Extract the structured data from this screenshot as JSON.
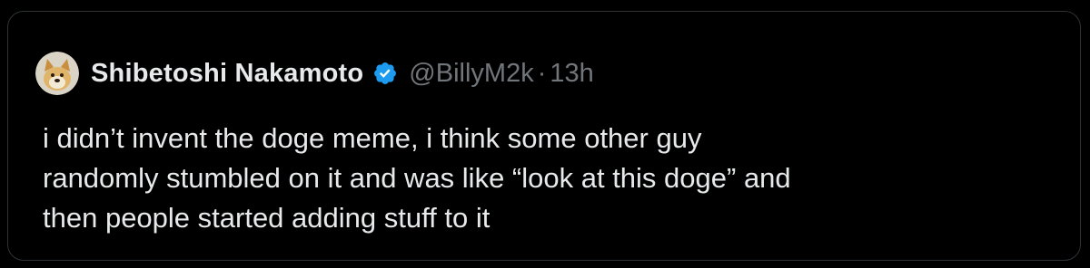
{
  "tweet": {
    "author_name": "Shibetoshi Nakamoto",
    "handle": "@BillyM2k",
    "separator": "·",
    "time": "13h",
    "verified_icon": "verified-badge-icon",
    "avatar_icon": "doge-avatar",
    "text_lines": [
      "i didn’t invent the doge meme, i think some other guy",
      "randomly stumbled on it and was like “look at this doge” and",
      "then people started adding stuff to it"
    ]
  },
  "colors": {
    "background": "#000000",
    "text_primary": "#e7e9ea",
    "text_secondary": "#71767b",
    "verified": "#1d9bf0",
    "border": "#2f3336"
  }
}
